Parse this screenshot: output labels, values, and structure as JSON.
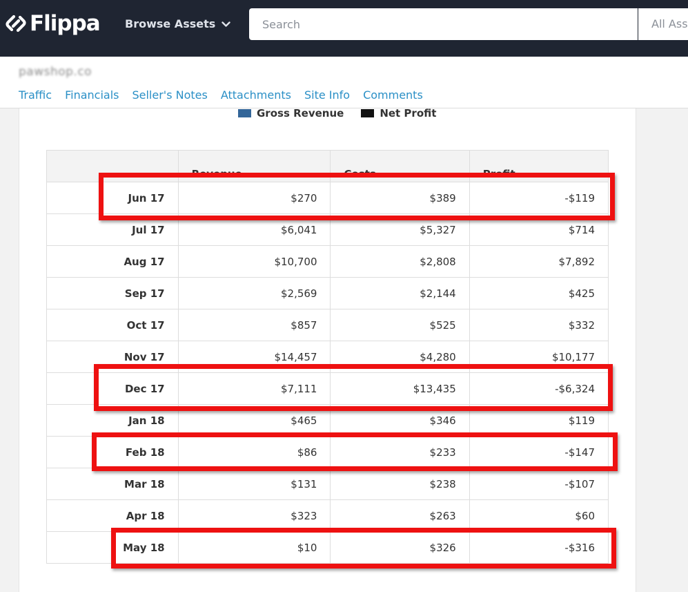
{
  "header": {
    "logo_text": "Flippa",
    "browse_label": "Browse Assets",
    "search_placeholder": "Search",
    "category_label": "All Assets"
  },
  "listing": {
    "title": "pawshop.co",
    "tabs": [
      "Traffic",
      "Financials",
      "Seller's Notes",
      "Attachments",
      "Site Info",
      "Comments"
    ]
  },
  "chart_data": {
    "type": "table",
    "legend": [
      {
        "name": "Gross Revenue",
        "color": "#336699"
      },
      {
        "name": "Net Profit",
        "color": "#111111"
      }
    ],
    "columns": [
      "",
      "Revenue",
      "Costs",
      "Profit"
    ],
    "rows": [
      [
        "Jun 17",
        "$270",
        "$389",
        "-$119"
      ],
      [
        "Jul 17",
        "$6,041",
        "$5,327",
        "$714"
      ],
      [
        "Aug 17",
        "$10,700",
        "$2,808",
        "$7,892"
      ],
      [
        "Sep 17",
        "$2,569",
        "$2,144",
        "$425"
      ],
      [
        "Oct 17",
        "$857",
        "$525",
        "$332"
      ],
      [
        "Nov 17",
        "$14,457",
        "$4,280",
        "$10,177"
      ],
      [
        "Dec 17",
        "$7,111",
        "$13,435",
        "-$6,324"
      ],
      [
        "Jan 18",
        "$465",
        "$346",
        "$119"
      ],
      [
        "Feb 18",
        "$86",
        "$233",
        "-$147"
      ],
      [
        "Mar 18",
        "$131",
        "$238",
        "-$107"
      ],
      [
        "Apr 18",
        "$323",
        "$263",
        "$60"
      ],
      [
        "May 18",
        "$10",
        "$326",
        "-$316"
      ]
    ],
    "highlighted_rows": [
      "Jun 17",
      "Dec 17",
      "Feb 18",
      "May 18"
    ]
  },
  "colors": {
    "nav_bg": "#1f2532",
    "link": "#2a8fc6",
    "highlight": "#ee1111"
  }
}
